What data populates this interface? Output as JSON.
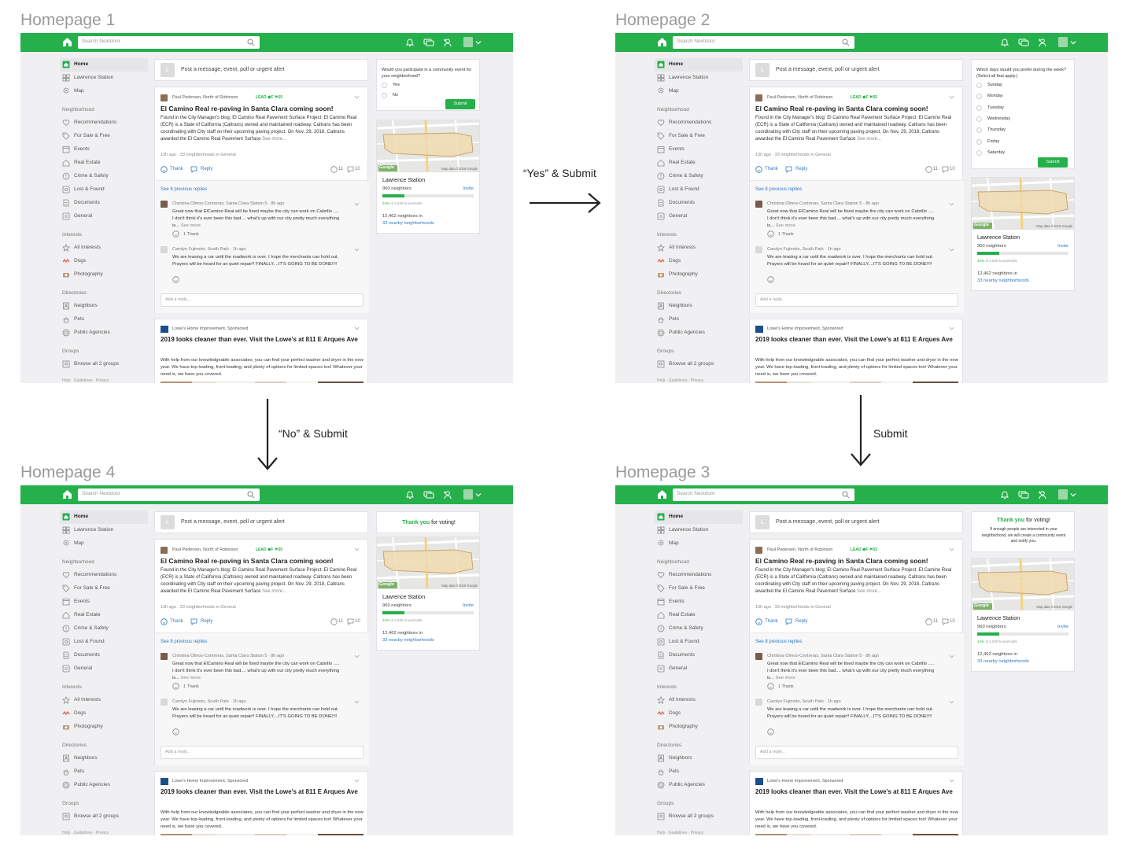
{
  "panels": [
    {
      "title": "Homepage 1",
      "variant": "poll_yesno"
    },
    {
      "title": "Homepage 2",
      "variant": "poll_days"
    },
    {
      "title": "Homepage 4",
      "variant": "thanks_only"
    },
    {
      "title": "Homepage 3",
      "variant": "thanks_notify"
    }
  ],
  "flow": {
    "yes_submit": "“Yes” & Submit",
    "no_submit": "“No” & Submit",
    "submit": "Submit"
  },
  "topbar": {
    "search_placeholder": "Search Nextdoor",
    "brand_color": "#25b04b"
  },
  "sidebar": {
    "items": [
      {
        "label": "Home",
        "icon": "home-icon"
      },
      {
        "label": "Lawrence Station",
        "icon": "neighborhood-icon"
      },
      {
        "label": "Map",
        "icon": "map-pin-icon"
      }
    ],
    "sections": [
      {
        "title": "Neighborhood",
        "items": [
          {
            "label": "Recommendations",
            "icon": "heart-icon"
          },
          {
            "label": "For Sale & Free",
            "icon": "tag-icon"
          },
          {
            "label": "Events",
            "icon": "calendar-icon"
          },
          {
            "label": "Real Estate",
            "icon": "house-icon"
          },
          {
            "label": "Crime & Safety",
            "icon": "alert-icon"
          },
          {
            "label": "Lost & Found",
            "icon": "lost-found-icon"
          },
          {
            "label": "Documents",
            "icon": "document-icon"
          },
          {
            "label": "General",
            "icon": "general-icon"
          }
        ]
      },
      {
        "title": "Interests",
        "items": [
          {
            "label": "All Interests",
            "icon": "star-icon"
          },
          {
            "label": "Dogs",
            "icon": "dogs-icon"
          },
          {
            "label": "Photography",
            "icon": "camera-icon"
          }
        ]
      },
      {
        "title": "Directories",
        "items": [
          {
            "label": "Neighbors",
            "icon": "contacts-icon"
          },
          {
            "label": "Pets",
            "icon": "pet-icon"
          },
          {
            "label": "Public Agencies",
            "icon": "agency-icon"
          }
        ]
      },
      {
        "title": "Groups",
        "items": [
          {
            "label": "Browse all 2 groups",
            "icon": "groups-icon"
          }
        ]
      }
    ],
    "footer": "Help · Guidelines · Privacy"
  },
  "composer": {
    "avatar_letter": "L",
    "placeholder": "Post a message, event, poll or urgent alert"
  },
  "post": {
    "author": "Paul Pedersen, North of Robinson",
    "badge": "LEAD  ♚F  ⚑55",
    "title": "El Camino Real re-paving in Santa Clara coming soon!",
    "body": "Found in the City Manager's blog: El Camino Real Pavement Surface Project: El Camino Real (ECR) is a State of California (Caltrans) owned and maintained roadway. Caltrans has been coordinating with City staff on their upcoming paving project. On Nov. 29, 2018, Caltrans awarded the El Camino Real Pavement Surface",
    "see_more": "See more...",
    "meta": "13h ago · 33 neighborhoods in General",
    "thank": "Thank",
    "reply": "Reply",
    "thanks_count": "11",
    "replies_count": "10",
    "previous_replies": "See 8 previous replies",
    "comments": [
      {
        "author": "Christina Olmos-Contreras, Santa Clara Station 5 · 8h ago",
        "body": "Great now that ElCamino Real will be fixed maybe the city can work on Cabrillo ..... I don't think it's ever been this bad.... what's up with our city pretty much everything is...",
        "see_more": "See more",
        "thank": "1 Thank"
      },
      {
        "author": "Carolyn Fujimoto, South Park · 1h ago",
        "body": "We are leasing a car until the roadwork is over.  I hope the merchants can hold out.  Prayers will be heard for an quiet repair!! FINALLY....IT'S GOING TO BE DONE!!!!"
      }
    ],
    "add_reply": "Add a reply..."
  },
  "ad": {
    "author": "Lowe's Home Improvement, Sponsored",
    "title": "2019 looks cleaner than ever. Visit the Lowe's at 811 E Arques Ave",
    "body": "With help from our knowledgeable associates, you can find your perfect washer and dryer in the new year. We have top-loading, front-loading, and plenty of options for limited spaces too! Whatever your need is, we have you covered."
  },
  "poll_yesno": {
    "question": "Would you participate in a community event for your neighborhood?",
    "options": [
      "Yes",
      "No"
    ],
    "submit": "Submit"
  },
  "poll_days": {
    "question": "Which days would you prefer during the week? (Select all that apply.)",
    "options": [
      "Sunday",
      "Monday",
      "Tuesday",
      "Wednesday",
      "Thursday",
      "Friday",
      "Saturday"
    ],
    "submit": "Submit"
  },
  "thanks": {
    "highlight": "Thank you",
    "rest": " for voting!",
    "notify": "If enough people are interested in your neighborhood, we will create a community event and notify you."
  },
  "map": {
    "google": "Google",
    "credit": "Map data ©2019 Google"
  },
  "location": {
    "name": "Lawrence Station",
    "neighbors": "960 neighbors",
    "invite": "Invite",
    "households_pct": "24%",
    "households_rest": " of 2,839 households",
    "households_fraction": 0.24,
    "nearby_count": "12,462 neighbors in",
    "nearby_link": "33 nearby neighborhoods"
  }
}
